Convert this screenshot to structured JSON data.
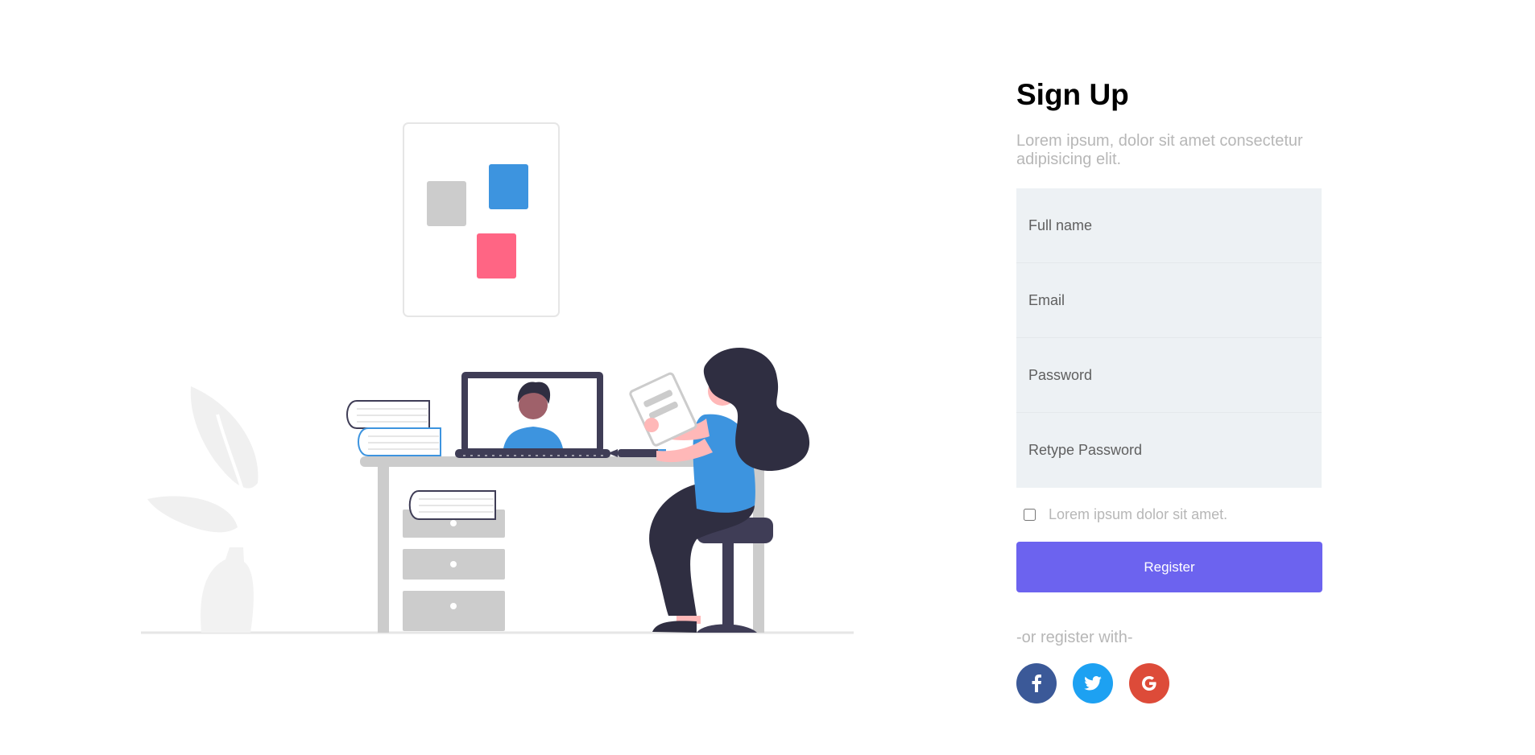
{
  "colors": {
    "accent": "#6c63ef",
    "field_bg": "#edf1f4",
    "muted_text": "#b7b7b7",
    "facebook": "#3b5998",
    "twitter": "#1da1f2",
    "google": "#dd4b39"
  },
  "illustration": {
    "icon": "person-at-desk-illustration"
  },
  "form": {
    "title": "Sign Up",
    "subtitle": "Lorem ipsum, dolor sit amet consectetur adipisicing elit.",
    "fields": [
      {
        "placeholder": "Full name",
        "value": ""
      },
      {
        "placeholder": "Email",
        "value": ""
      },
      {
        "placeholder": "Password",
        "value": ""
      },
      {
        "placeholder": "Retype Password",
        "value": ""
      }
    ],
    "checkbox_label": "Lorem ipsum dolor sit amet.",
    "checkbox_checked": false,
    "register_label": "Register",
    "or_text": "-or register with-",
    "socials": [
      {
        "icon": "facebook-icon",
        "glyph": "f"
      },
      {
        "icon": "twitter-icon",
        "glyph": "t"
      },
      {
        "icon": "google-icon",
        "glyph": "G"
      }
    ]
  }
}
